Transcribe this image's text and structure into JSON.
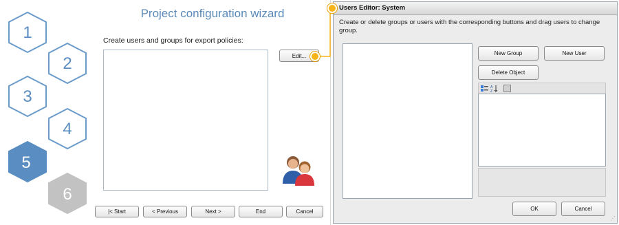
{
  "wizard": {
    "title": "Project configuration wizard",
    "subtitle": "Create users and groups for export policies:",
    "edit_label": "Edit...",
    "steps": [
      "1",
      "2",
      "3",
      "4",
      "5",
      "6"
    ],
    "active_step": "5",
    "nav": {
      "start": "|< Start",
      "previous": "< Previous",
      "next": "Next >",
      "end": "End",
      "cancel": "Cancel"
    }
  },
  "editor": {
    "title": "Users Editor: System",
    "description": "Create or delete groups or users with the corresponding buttons and drag users to change group.",
    "new_group": "New Group",
    "new_user": "New User",
    "delete_object": "Delete Object",
    "ok": "OK",
    "cancel": "Cancel"
  },
  "colors": {
    "active_hex": "#5a8dc1",
    "future_hex": "#c2c2c2",
    "outline_hex": "#6b9bcb",
    "callout": "#f7b418"
  }
}
